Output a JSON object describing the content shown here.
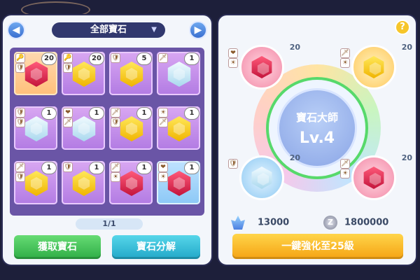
{
  "category": {
    "label": "全部寶石"
  },
  "grid": {
    "slots": [
      {
        "gem": "red",
        "count": "20",
        "sel": true,
        "icons": [
          "🔑",
          "🛡"
        ]
      },
      {
        "gem": "yellow",
        "count": "20",
        "icons": [
          "🔑",
          "🛡"
        ]
      },
      {
        "gem": "yellow",
        "count": "5",
        "icons": [
          "🛡"
        ]
      },
      {
        "gem": "white",
        "count": "1",
        "icons": [
          "🗡"
        ]
      },
      {
        "gem": "white",
        "count": "1",
        "icons": [
          "🛡",
          "🛡"
        ]
      },
      {
        "gem": "white",
        "count": "1",
        "icons": [
          "❤",
          "🗡"
        ]
      },
      {
        "gem": "yellow",
        "count": "1",
        "icons": [
          "🗡",
          "🛡"
        ]
      },
      {
        "gem": "yellow",
        "count": "1",
        "icons": [
          "☀",
          "🗡"
        ]
      },
      {
        "gem": "yellow",
        "count": "1",
        "icons": [
          "🗡",
          "🛡"
        ]
      },
      {
        "gem": "yellow",
        "count": "1",
        "icons": [
          "🛡"
        ]
      },
      {
        "gem": "red",
        "count": "1",
        "icons": [
          "🗡",
          "☀"
        ]
      },
      {
        "gem": "red",
        "count": "1",
        "blue": true,
        "icons": [
          "❤",
          "☀"
        ]
      }
    ]
  },
  "pager": {
    "label": "1/1"
  },
  "buttons": {
    "obtain": "獲取寶石",
    "decompose": "寶石分解",
    "upgrade": "一鍵強化至25級"
  },
  "master": {
    "title": "寶石大師",
    "level": "Lv.4"
  },
  "orbs": [
    {
      "gem": "red",
      "count": "20"
    },
    {
      "gem": "yellow",
      "count": "20"
    },
    {
      "gem": "white",
      "count": "20"
    },
    {
      "gem": "red",
      "count": "20"
    }
  ],
  "resources": {
    "crystal": "13000",
    "coin": "1800000",
    "coin_symbol": "Z"
  },
  "help": "?",
  "nav": {
    "prev": "◀",
    "next": "▶"
  }
}
